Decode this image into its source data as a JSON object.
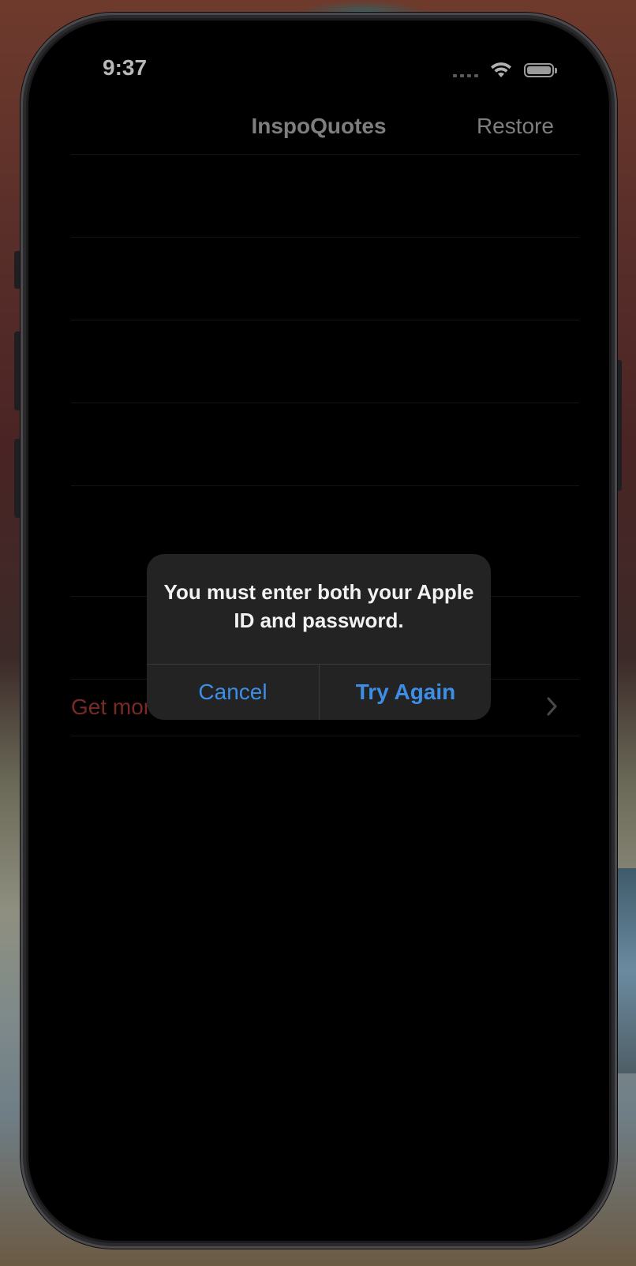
{
  "status_bar": {
    "time": "9:37",
    "icons": [
      "cellular-signal-icon",
      "wifi-icon",
      "battery-icon"
    ]
  },
  "nav": {
    "title": "InspoQuotes",
    "restore_label": "Restore"
  },
  "list": {
    "visible_row_label": "Get mor",
    "row_icon": "chevron-right-icon"
  },
  "alert": {
    "message": "You must enter both your Apple ID and password.",
    "cancel_label": "Cancel",
    "retry_label": "Try Again"
  },
  "colors": {
    "accent_blue": "#3d8ee6",
    "row_text_red": "#7a2a25",
    "alert_bg": "#232323",
    "screen_bg": "#000000"
  }
}
